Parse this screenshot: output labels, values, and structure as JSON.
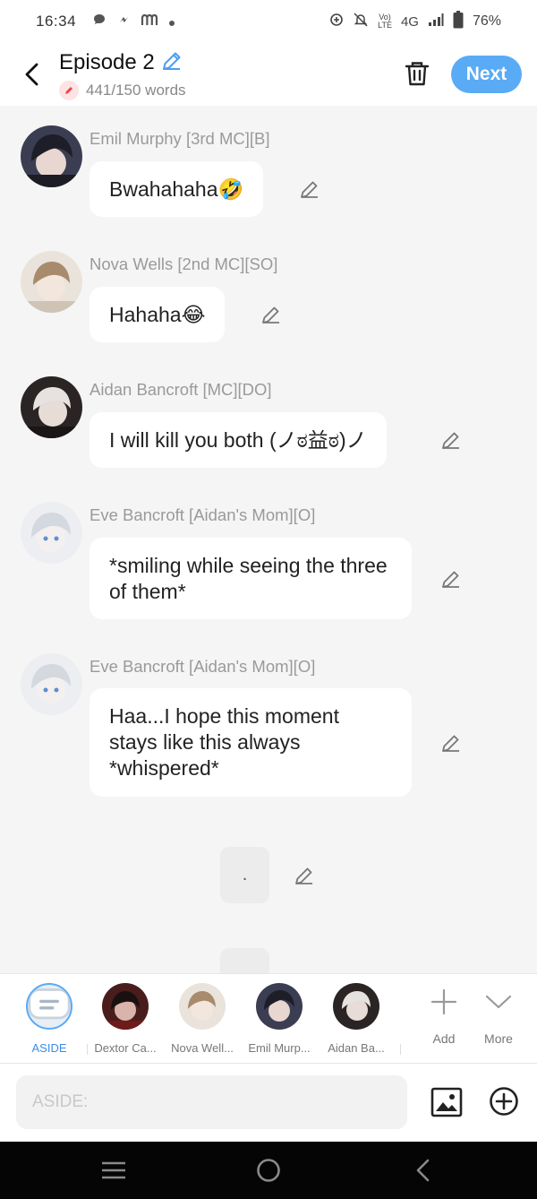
{
  "status": {
    "time": "16:34",
    "network": "4G",
    "battery": "76%"
  },
  "header": {
    "title": "Episode 2",
    "word_count": "441/150 words",
    "next_label": "Next"
  },
  "messages": [
    {
      "name": "Emil Murphy [3rd MC][B]",
      "text": "Bwahahaha🤣"
    },
    {
      "name": "Nova Wells [2nd MC][SO]",
      "text": "Hahaha😂"
    },
    {
      "name": "Aidan Bancroft [MC][DO]",
      "text": "I will kill you both (ノಠ益ಠ)ノ"
    },
    {
      "name": "Eve Bancroft [Aidan's Mom][O]",
      "text": "*smiling while seeing the three of them*"
    },
    {
      "name": "Eve Bancroft [Aidan's Mom][O]",
      "text": "Haa...I hope this moment stays like this always *whispered*"
    }
  ],
  "narration": {
    "text": "."
  },
  "character_bar": {
    "aside_label": "ASIDE",
    "characters": [
      "Dextor Ca...",
      "Nova Well...",
      "Emil Murp...",
      "Aidan Ba..."
    ],
    "add_label": "Add",
    "more_label": "More"
  },
  "composer": {
    "placeholder": "ASIDE:"
  },
  "colors": {
    "accent": "#5aabf5",
    "background": "#f5f5f5"
  }
}
